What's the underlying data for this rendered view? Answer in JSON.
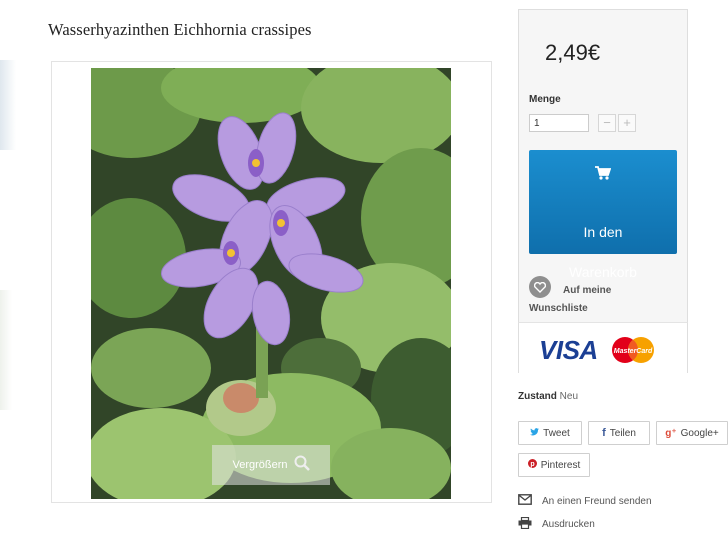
{
  "product": {
    "title": "Wasserhyazinthen Eichhornia crassipes",
    "price": "2,49€",
    "zoom_label": "Vergrößern"
  },
  "purchase": {
    "quantity_label": "Menge",
    "quantity_value": "1",
    "minus": "−",
    "plus": "+",
    "cart_line1": "In den",
    "cart_line2": "Warenkorb",
    "wishlist_label": "Auf meine Wunschliste"
  },
  "payment": {
    "visa": "VISA",
    "mastercard": "MasterCard"
  },
  "condition": {
    "label": "Zustand",
    "value": "Neu"
  },
  "share": {
    "tweet": "Tweet",
    "facebook": "Teilen",
    "googleplus": "Google+",
    "pinterest": "Pinterest"
  },
  "links": {
    "send_friend": "An einen Freund senden",
    "print": "Ausdrucken"
  },
  "colors": {
    "cart_button": "#1678bb",
    "visa_blue": "#1b3f94",
    "twitter": "#2aa4e6",
    "facebook": "#3b5998",
    "googleplus": "#dd4b39",
    "pinterest": "#cb2027"
  },
  "icons": {
    "cart": "shopping-cart-icon",
    "heart": "heart-icon",
    "zoom": "magnifier-icon",
    "mail": "envelope-icon",
    "print": "printer-icon"
  }
}
